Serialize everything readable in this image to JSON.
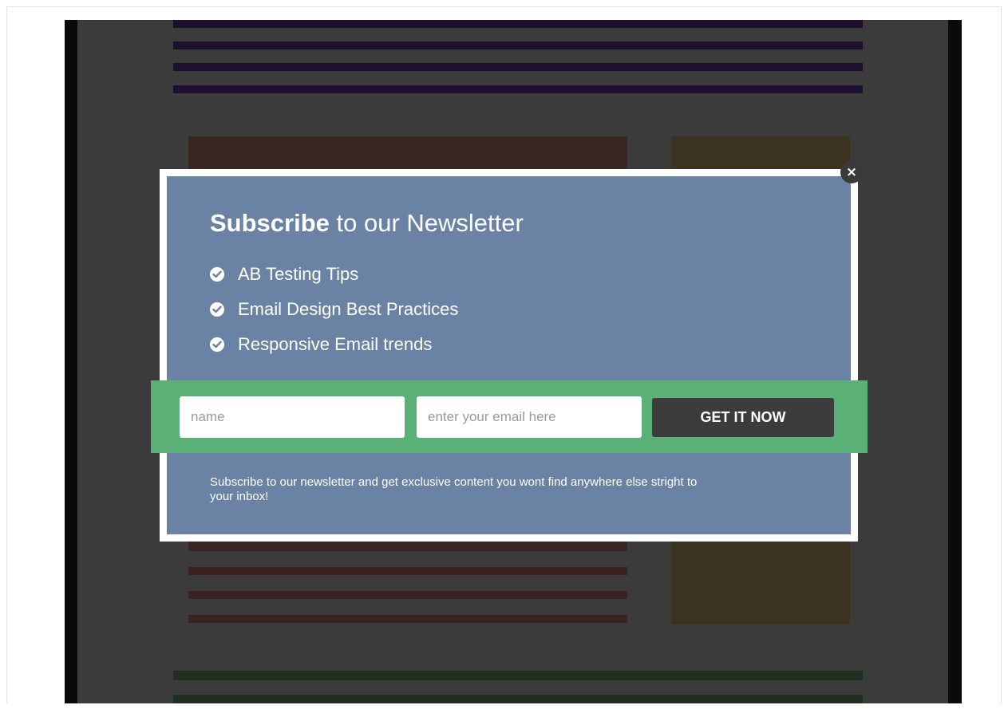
{
  "modal": {
    "title_strong": "Subscribe",
    "title_rest": " to our Newsletter",
    "features": [
      {
        "label": "AB Testing Tips",
        "icon": "check-circle-icon"
      },
      {
        "label": "Email Design Best Practices",
        "icon": "check-circle-icon"
      },
      {
        "label": "Responsive Email trends",
        "icon": "check-circle-icon"
      }
    ],
    "form": {
      "name_placeholder": "name",
      "email_placeholder": "enter your email here",
      "submit_label": "GET IT NOW"
    },
    "footnote": "Subscribe to our newsletter and get exclusive content you wont find anywhere else stright to your inbox!",
    "close_glyph": "×"
  },
  "colors": {
    "modal_panel": "#6a82a4",
    "form_band": "#5bb077",
    "submit_button": "#3c3c3c",
    "overlay_background": "#3b3b3b"
  }
}
